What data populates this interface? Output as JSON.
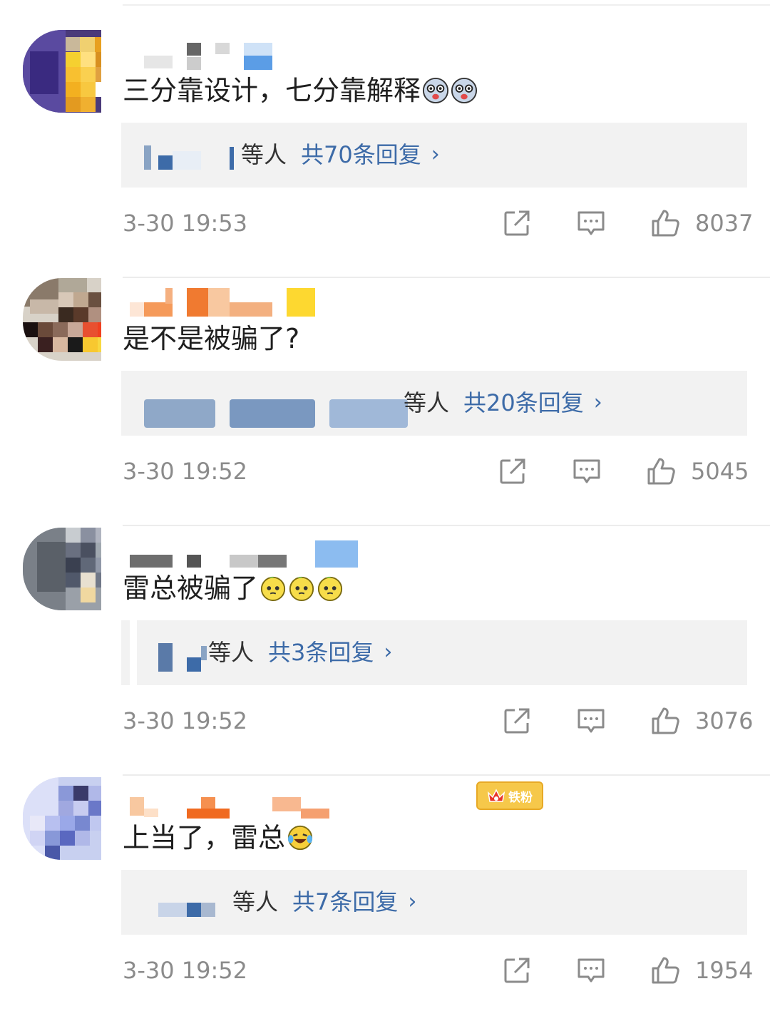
{
  "comments": [
    {
      "text": "三分靠设计，七分靠解释",
      "emoji": [
        "ghost-face-icon",
        "ghost-face-icon"
      ],
      "reply_suffix": "等人",
      "reply_count": "共70条回复",
      "reply_chevron": "›",
      "time": "3-30 19:53",
      "likes": "8037"
    },
    {
      "text": "是不是被骗了?",
      "emoji": [],
      "reply_suffix": "等人",
      "reply_count": "共20条回复",
      "reply_chevron": "›",
      "time": "3-30 19:52",
      "likes": "5045"
    },
    {
      "text": "雷总被骗了",
      "emoji": [
        "pleading-face-icon",
        "pleading-face-icon",
        "pleading-face-icon"
      ],
      "reply_suffix": "等人",
      "reply_count": "共3条回复",
      "reply_chevron": "›",
      "time": "3-30 19:52",
      "likes": "3076"
    },
    {
      "text": "上当了，雷总",
      "emoji": [
        "laughing-crying-face-icon"
      ],
      "badge": "铁粉",
      "reply_suffix": "等人",
      "reply_count": "共7条回复",
      "reply_chevron": "›",
      "time": "3-30 19:52",
      "likes": "1954"
    }
  ],
  "icons": {
    "share": "share-icon",
    "comment": "comment-icon",
    "like": "thumbs-up-icon"
  },
  "colors": {
    "link_blue": "#3d6ba8",
    "meta_gray": "#8b8b8b",
    "reply_bg": "#f2f2f2",
    "badge_gold": "#f6c84a"
  }
}
